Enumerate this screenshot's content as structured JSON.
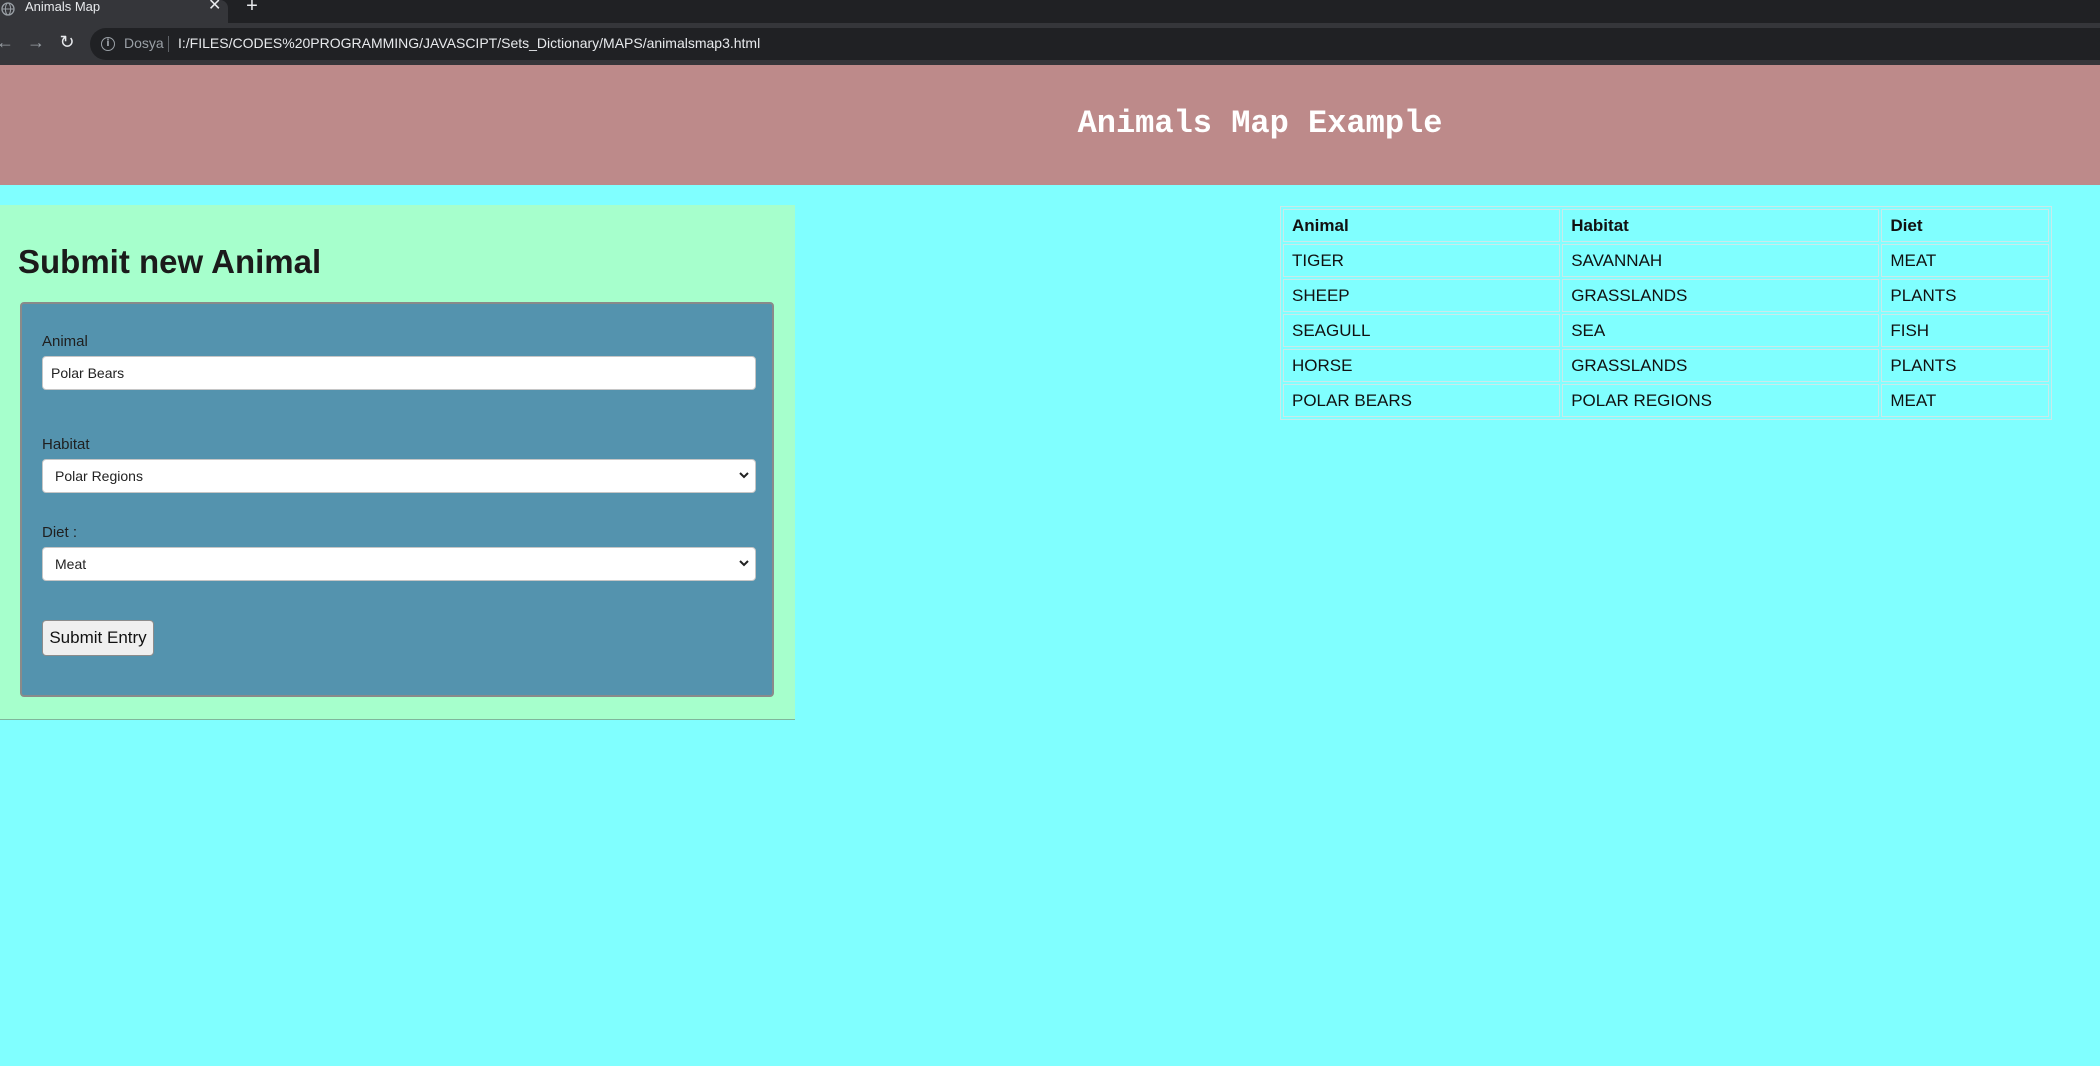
{
  "browser": {
    "tab_title": "Animals Map",
    "close_glyph": "✕",
    "new_tab_glyph": "+",
    "back_glyph": "←",
    "forward_glyph": "→",
    "reload_glyph": "↻",
    "info_glyph": "i",
    "site_label": "Dosya",
    "url": "I:/FILES/CODES%20PROGRAMMING/JAVASCIPT/Sets_Dictionary/MAPS/animalsmap3.html"
  },
  "page": {
    "title": "Animals Map Example"
  },
  "form": {
    "heading": "Submit new Animal",
    "animal_label": "Animal",
    "animal_value": "Polar Bears",
    "habitat_label": "Habitat",
    "habitat_selected": "Polar Regions",
    "diet_label": "Diet :",
    "diet_selected": "Meat",
    "submit_label": "Submit Entry"
  },
  "table": {
    "headers": [
      "Animal",
      "Habitat",
      "Diet"
    ],
    "rows": [
      [
        "TIGER",
        "SAVANNAH",
        "MEAT"
      ],
      [
        "SHEEP",
        "GRASSLANDS",
        "PLANTS"
      ],
      [
        "SEAGULL",
        "SEA",
        "FISH"
      ],
      [
        "HORSE",
        "GRASSLANDS",
        "PLANTS"
      ],
      [
        "POLAR BEARS",
        "POLAR REGIONS",
        "MEAT"
      ]
    ]
  },
  "icons": {
    "favicon": "globe-icon",
    "select_arrow": "chevron-down-icon"
  },
  "colors": {
    "header_bg": "#bd8a8a",
    "page_bg": "#80ffff",
    "form_panel_bg": "#a6ffcc",
    "form_box_bg": "#5493ae"
  }
}
